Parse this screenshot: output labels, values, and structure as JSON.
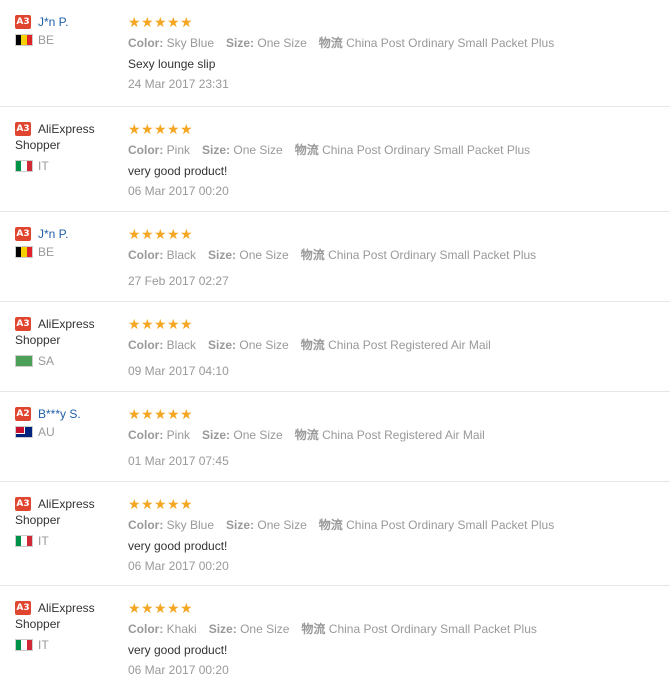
{
  "labels": {
    "color": "Color:",
    "size": "Size:",
    "logistics": "物流"
  },
  "reviews": [
    {
      "badge": "A3",
      "name": "J*n P.",
      "name_line2": "",
      "country": "BE",
      "color": "Sky Blue",
      "size": "One Size",
      "logistics": "China Post Ordinary Small Packet Plus",
      "feedback": "Sexy lounge slip",
      "date": "24 Mar 2017 23:31",
      "rating": 5
    },
    {
      "badge": "A3",
      "name": "AliExpress",
      "name_line2": "Shopper",
      "country": "IT",
      "color": "Pink",
      "size": "One Size",
      "logistics": "China Post Ordinary Small Packet Plus",
      "feedback": "very good product!",
      "date": "06 Mar 2017 00:20",
      "rating": 5
    },
    {
      "badge": "A3",
      "name": "J*n P.",
      "name_line2": "",
      "country": "BE",
      "color": "Black",
      "size": "One Size",
      "logistics": "China Post Ordinary Small Packet Plus",
      "feedback": "",
      "date": "27 Feb 2017 02:27",
      "rating": 5
    },
    {
      "badge": "A3",
      "name": "AliExpress",
      "name_line2": "Shopper",
      "country": "SA",
      "color": "Black",
      "size": "One Size",
      "logistics": "China Post Registered Air Mail",
      "feedback": "",
      "date": "09 Mar 2017 04:10",
      "rating": 5
    },
    {
      "badge": "A2",
      "name": "B***y S.",
      "name_line2": "",
      "country": "AU",
      "color": "Pink",
      "size": "One Size",
      "logistics": "China Post Registered Air Mail",
      "feedback": "",
      "date": "01 Mar 2017 07:45",
      "rating": 5
    },
    {
      "badge": "A3",
      "name": "AliExpress",
      "name_line2": "Shopper",
      "country": "IT",
      "color": "Sky Blue",
      "size": "One Size",
      "logistics": "China Post Ordinary Small Packet Plus",
      "feedback": "very good product!",
      "date": "06 Mar 2017 00:20",
      "rating": 5
    },
    {
      "badge": "A3",
      "name": "AliExpress",
      "name_line2": "Shopper",
      "country": "IT",
      "color": "Khaki",
      "size": "One Size",
      "logistics": "China Post Ordinary Small Packet Plus",
      "feedback": "very good product!",
      "date": "06 Mar 2017 00:20",
      "rating": 5
    }
  ]
}
